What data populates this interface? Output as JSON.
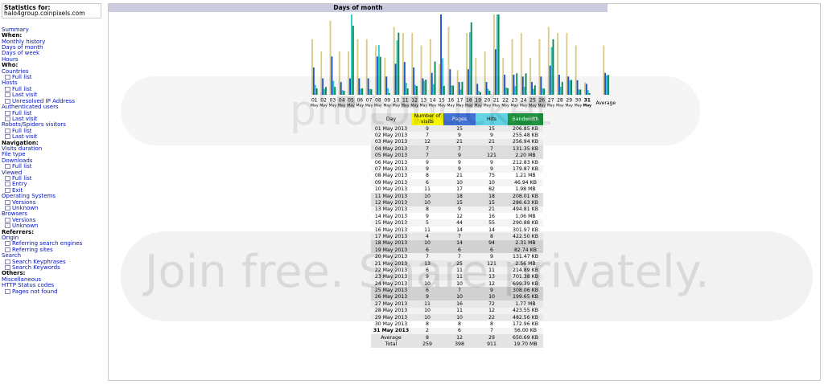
{
  "stats": {
    "title": "Statistics for:",
    "host": "halo4group.coinpixels.com"
  },
  "menu": {
    "summary": "Summary",
    "when": "When:",
    "when_items": [
      "Monthly history",
      "Days of month",
      "Days of week",
      "Hours"
    ],
    "who": "Who:",
    "countries": "Countries",
    "countries_sub": [
      "Full list"
    ],
    "hosts": "Hosts",
    "hosts_sub": [
      "Full list",
      "Last visit",
      "Unresolved IP Address"
    ],
    "authusers": "Authenticated users",
    "authusers_sub": [
      "Full list",
      "Last visit"
    ],
    "robots": "Robots/Spiders visitors",
    "robots_sub": [
      "Full list",
      "Last visit"
    ],
    "navigation": "Navigation:",
    "visits_duration": "Visits duration",
    "file_type": "File type",
    "downloads": "Downloads",
    "downloads_sub": [
      "Full list"
    ],
    "viewed": "Viewed",
    "viewed_sub": [
      "Full list",
      "Entry",
      "Exit"
    ],
    "os": "Operating Systems",
    "os_sub": [
      "Versions",
      "Unknown"
    ],
    "browsers": "Browsers",
    "browsers_sub": [
      "Versions",
      "Unknown"
    ],
    "referrers": "Referrers:",
    "origin": "Origin",
    "origin_sub": [
      "Referring search engines",
      "Referring sites"
    ],
    "search": "Search",
    "search_sub": [
      "Search Keyphrases",
      "Search Keywords"
    ],
    "others": "Others:",
    "misc": "Miscellaneous",
    "http": "HTTP Status codes",
    "http_sub": [
      "Pages not found"
    ]
  },
  "section_title": "Days of month",
  "colors": {
    "visits": "#d8cc88",
    "pages": "#2255cc",
    "hits": "#33cccc",
    "bandwidth": "#118855",
    "weekend": "#d8d8d8"
  },
  "table": {
    "headers": [
      "Day",
      "Number of visits",
      "Pages",
      "Hits",
      "Bandwidth"
    ],
    "rows": [
      [
        "01 May 2013",
        "9",
        "15",
        "15",
        "206.85 KB"
      ],
      [
        "02 May 2013",
        "7",
        "9",
        "9",
        "255.48 KB"
      ],
      [
        "03 May 2013",
        "12",
        "21",
        "21",
        "256.94 KB"
      ],
      [
        "04 May 2013",
        "7",
        "7",
        "7",
        "131.35 KB"
      ],
      [
        "05 May 2013",
        "7",
        "9",
        "121",
        "2.20 MB"
      ],
      [
        "06 May 2013",
        "9",
        "9",
        "9",
        "212.83 KB"
      ],
      [
        "07 May 2013",
        "9",
        "9",
        "9",
        "179.87 KB"
      ],
      [
        "08 May 2013",
        "8",
        "21",
        "75",
        "1.21 MB"
      ],
      [
        "09 May 2013",
        "6",
        "10",
        "10",
        "46.94 KB"
      ],
      [
        "10 May 2013",
        "11",
        "17",
        "82",
        "1.98 MB"
      ],
      [
        "11 May 2013",
        "10",
        "18",
        "18",
        "208.01 KB"
      ],
      [
        "12 May 2013",
        "10",
        "15",
        "15",
        "286.63 KB"
      ],
      [
        "13 May 2013",
        "8",
        "9",
        "21",
        "494.81 KB"
      ],
      [
        "14 May 2013",
        "9",
        "12",
        "16",
        "1.06 MB"
      ],
      [
        "15 May 2013",
        "5",
        "44",
        "55",
        "290.88 KB"
      ],
      [
        "16 May 2013",
        "11",
        "14",
        "14",
        "301.97 KB"
      ],
      [
        "17 May 2013",
        "4",
        "7",
        "8",
        "422.50 KB"
      ],
      [
        "18 May 2013",
        "10",
        "14",
        "94",
        "2.31 MB"
      ],
      [
        "19 May 2013",
        "6",
        "6",
        "6",
        "82.74 KB"
      ],
      [
        "20 May 2013",
        "7",
        "7",
        "9",
        "131.47 KB"
      ],
      [
        "21 May 2013",
        "13",
        "25",
        "121",
        "2.56 MB"
      ],
      [
        "22 May 2013",
        "6",
        "11",
        "11",
        "214.89 KB"
      ],
      [
        "23 May 2013",
        "9",
        "11",
        "13",
        "701.38 KB"
      ],
      [
        "24 May 2013",
        "10",
        "10",
        "12",
        "699.39 KB"
      ],
      [
        "25 May 2013",
        "6",
        "7",
        "9",
        "308.06 KB"
      ],
      [
        "26 May 2013",
        "9",
        "10",
        "10",
        "199.65 KB"
      ],
      [
        "27 May 2013",
        "11",
        "16",
        "72",
        "1.77 MB"
      ],
      [
        "28 May 2013",
        "10",
        "11",
        "12",
        "423.55 KB"
      ],
      [
        "29 May 2013",
        "10",
        "10",
        "22",
        "482.56 KB"
      ],
      [
        "30 May 2013",
        "8",
        "8",
        "8",
        "172.96 KB"
      ],
      [
        "31 May 2013",
        "2",
        "6",
        "7",
        "56.00 KB"
      ]
    ],
    "average": [
      "Average",
      "8",
      "12",
      "29",
      "650.69 KB"
    ],
    "total": [
      "Total",
      "259",
      "398",
      "911",
      "19.70 MB"
    ]
  },
  "chart_data": {
    "type": "bar",
    "categories": [
      "01",
      "02",
      "03",
      "04",
      "05",
      "06",
      "07",
      "08",
      "09",
      "10",
      "11",
      "12",
      "13",
      "14",
      "15",
      "16",
      "17",
      "18",
      "19",
      "20",
      "21",
      "22",
      "23",
      "24",
      "25",
      "26",
      "27",
      "28",
      "29",
      "30",
      "31"
    ],
    "category_sublabel": "May",
    "average_label": "Average",
    "weekend_days": [
      "04",
      "05",
      "11",
      "12",
      "18",
      "19",
      "25",
      "26"
    ],
    "current_day": "31",
    "series": [
      {
        "name": "Number of visits",
        "values": [
          9,
          7,
          12,
          7,
          7,
          9,
          9,
          8,
          6,
          11,
          10,
          10,
          8,
          9,
          5,
          11,
          4,
          10,
          6,
          7,
          13,
          6,
          9,
          10,
          6,
          9,
          11,
          10,
          10,
          8,
          2
        ]
      },
      {
        "name": "Pages",
        "values": [
          15,
          9,
          21,
          7,
          9,
          9,
          9,
          21,
          10,
          17,
          18,
          15,
          9,
          12,
          44,
          14,
          7,
          14,
          6,
          7,
          25,
          11,
          11,
          10,
          7,
          10,
          16,
          11,
          10,
          8,
          6
        ]
      },
      {
        "name": "Hits",
        "values": [
          15,
          9,
          21,
          7,
          121,
          9,
          9,
          75,
          10,
          82,
          18,
          15,
          21,
          16,
          55,
          14,
          8,
          94,
          6,
          9,
          121,
          11,
          13,
          12,
          9,
          10,
          72,
          12,
          22,
          8,
          7
        ]
      },
      {
        "name": "Bandwidth",
        "values": [
          206.85,
          255.48,
          256.94,
          131.35,
          2252.8,
          212.83,
          179.87,
          1239.04,
          46.94,
          2027.52,
          208.01,
          286.63,
          494.81,
          1085.44,
          290.88,
          301.97,
          422.5,
          2365.44,
          82.74,
          131.47,
          2621.44,
          214.89,
          701.38,
          699.39,
          308.06,
          199.65,
          1812.48,
          423.55,
          482.56,
          172.96,
          56.0
        ],
        "unit": "KB"
      }
    ],
    "average": {
      "visits": 8,
      "pages": 12,
      "hits": 29,
      "bandwidth": 650.69
    }
  }
}
